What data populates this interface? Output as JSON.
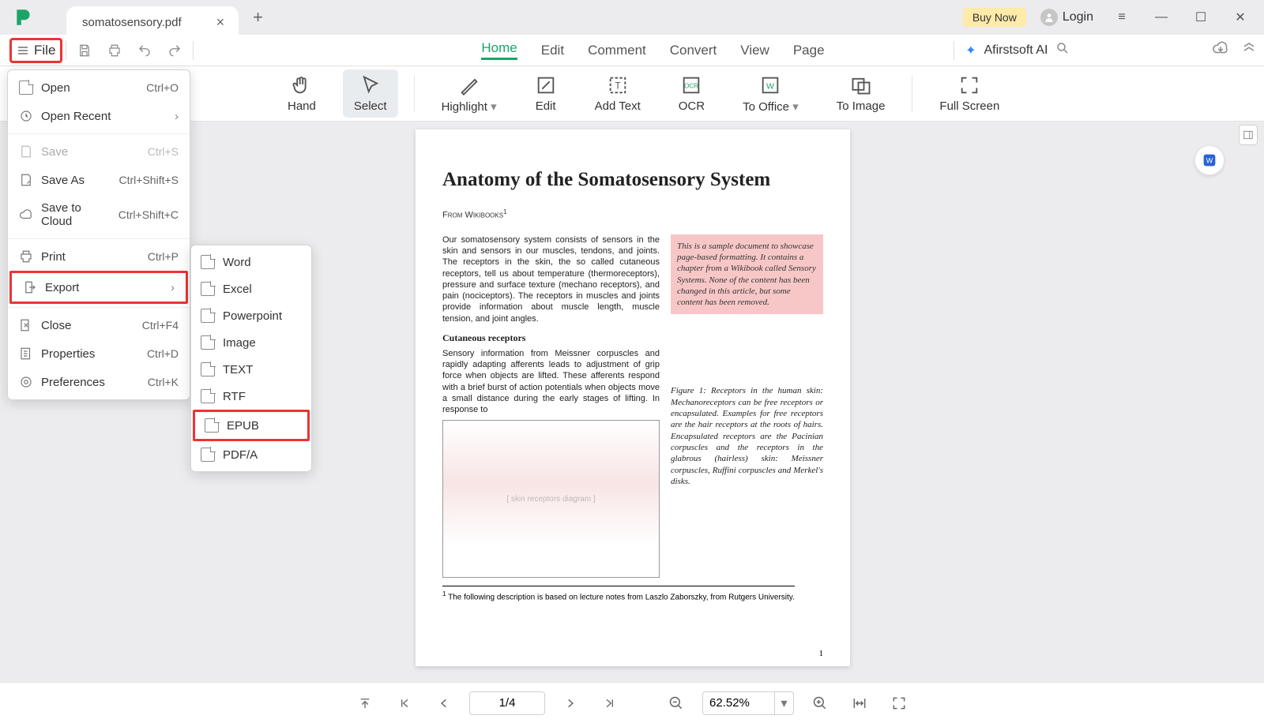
{
  "title_tab": "somatosensory.pdf",
  "buy_now": "Buy Now",
  "login_label": "Login",
  "menu": {
    "file": "File",
    "tabs": [
      "Home",
      "Edit",
      "Comment",
      "Convert",
      "View",
      "Page"
    ],
    "ai": "Afirstsoft AI"
  },
  "ribbon": {
    "hand": "Hand",
    "select": "Select",
    "highlight": "Highlight",
    "edit": "Edit",
    "add_text": "Add Text",
    "ocr": "OCR",
    "to_office": "To Office",
    "to_image": "To Image",
    "full_screen": "Full Screen"
  },
  "file_menu": {
    "open": {
      "label": "Open",
      "shortcut": "Ctrl+O"
    },
    "open_recent": {
      "label": "Open Recent"
    },
    "save": {
      "label": "Save",
      "shortcut": "Ctrl+S"
    },
    "save_as": {
      "label": "Save As",
      "shortcut": "Ctrl+Shift+S"
    },
    "save_cloud": {
      "label": "Save to Cloud",
      "shortcut": "Ctrl+Shift+C"
    },
    "print": {
      "label": "Print",
      "shortcut": "Ctrl+P"
    },
    "export": {
      "label": "Export"
    },
    "close": {
      "label": "Close",
      "shortcut": "Ctrl+F4"
    },
    "properties": {
      "label": "Properties",
      "shortcut": "Ctrl+D"
    },
    "preferences": {
      "label": "Preferences",
      "shortcut": "Ctrl+K"
    }
  },
  "export_menu": [
    "Word",
    "Excel",
    "Powerpoint",
    "Image",
    "TEXT",
    "RTF",
    "EPUB",
    "PDF/A"
  ],
  "doc": {
    "title": "Anatomy of the Somatosensory System",
    "from": "From Wikibooks",
    "sup": "1",
    "p1": "Our somatosensory system consists of sensors in the skin and sensors in our muscles, tendons, and joints. The receptors in the skin, the so called cutaneous receptors, tell us about temperature (thermoreceptors), pressure and surface texture (mechano receptors), and pain (nociceptors). The receptors in muscles and joints provide information about muscle length, muscle tension, and joint angles.",
    "pink": "This is a sample document to showcase page-based formatting. It contains a chapter from a Wikibook called Sensory Systems. None of the content has been changed in this article, but some content has been removed.",
    "sub": "Cutaneous receptors",
    "p2": "Sensory information from Meissner corpuscles and rapidly adapting afferents leads to adjustment of grip force when objects are lifted. These afferents respond with a brief burst of action potentials when objects move a small distance during the early stages of lifting. In response to",
    "caption": "Figure 1: Receptors in the human skin: Mechanoreceptors can be free receptors or encapsulated. Examples for free receptors are the hair receptors at the roots of hairs. Encapsulated receptors are the Pacinian corpuscles and the receptors in the glabrous (hairless) skin: Meissner corpuscles, Ruffini corpuscles and Merkel's disks.",
    "footnote": "The following description is based on lecture notes from Laszlo Zaborszky, from Rutgers University.",
    "page_num": "1"
  },
  "status": {
    "page": "1/4",
    "zoom": "62.52%"
  }
}
